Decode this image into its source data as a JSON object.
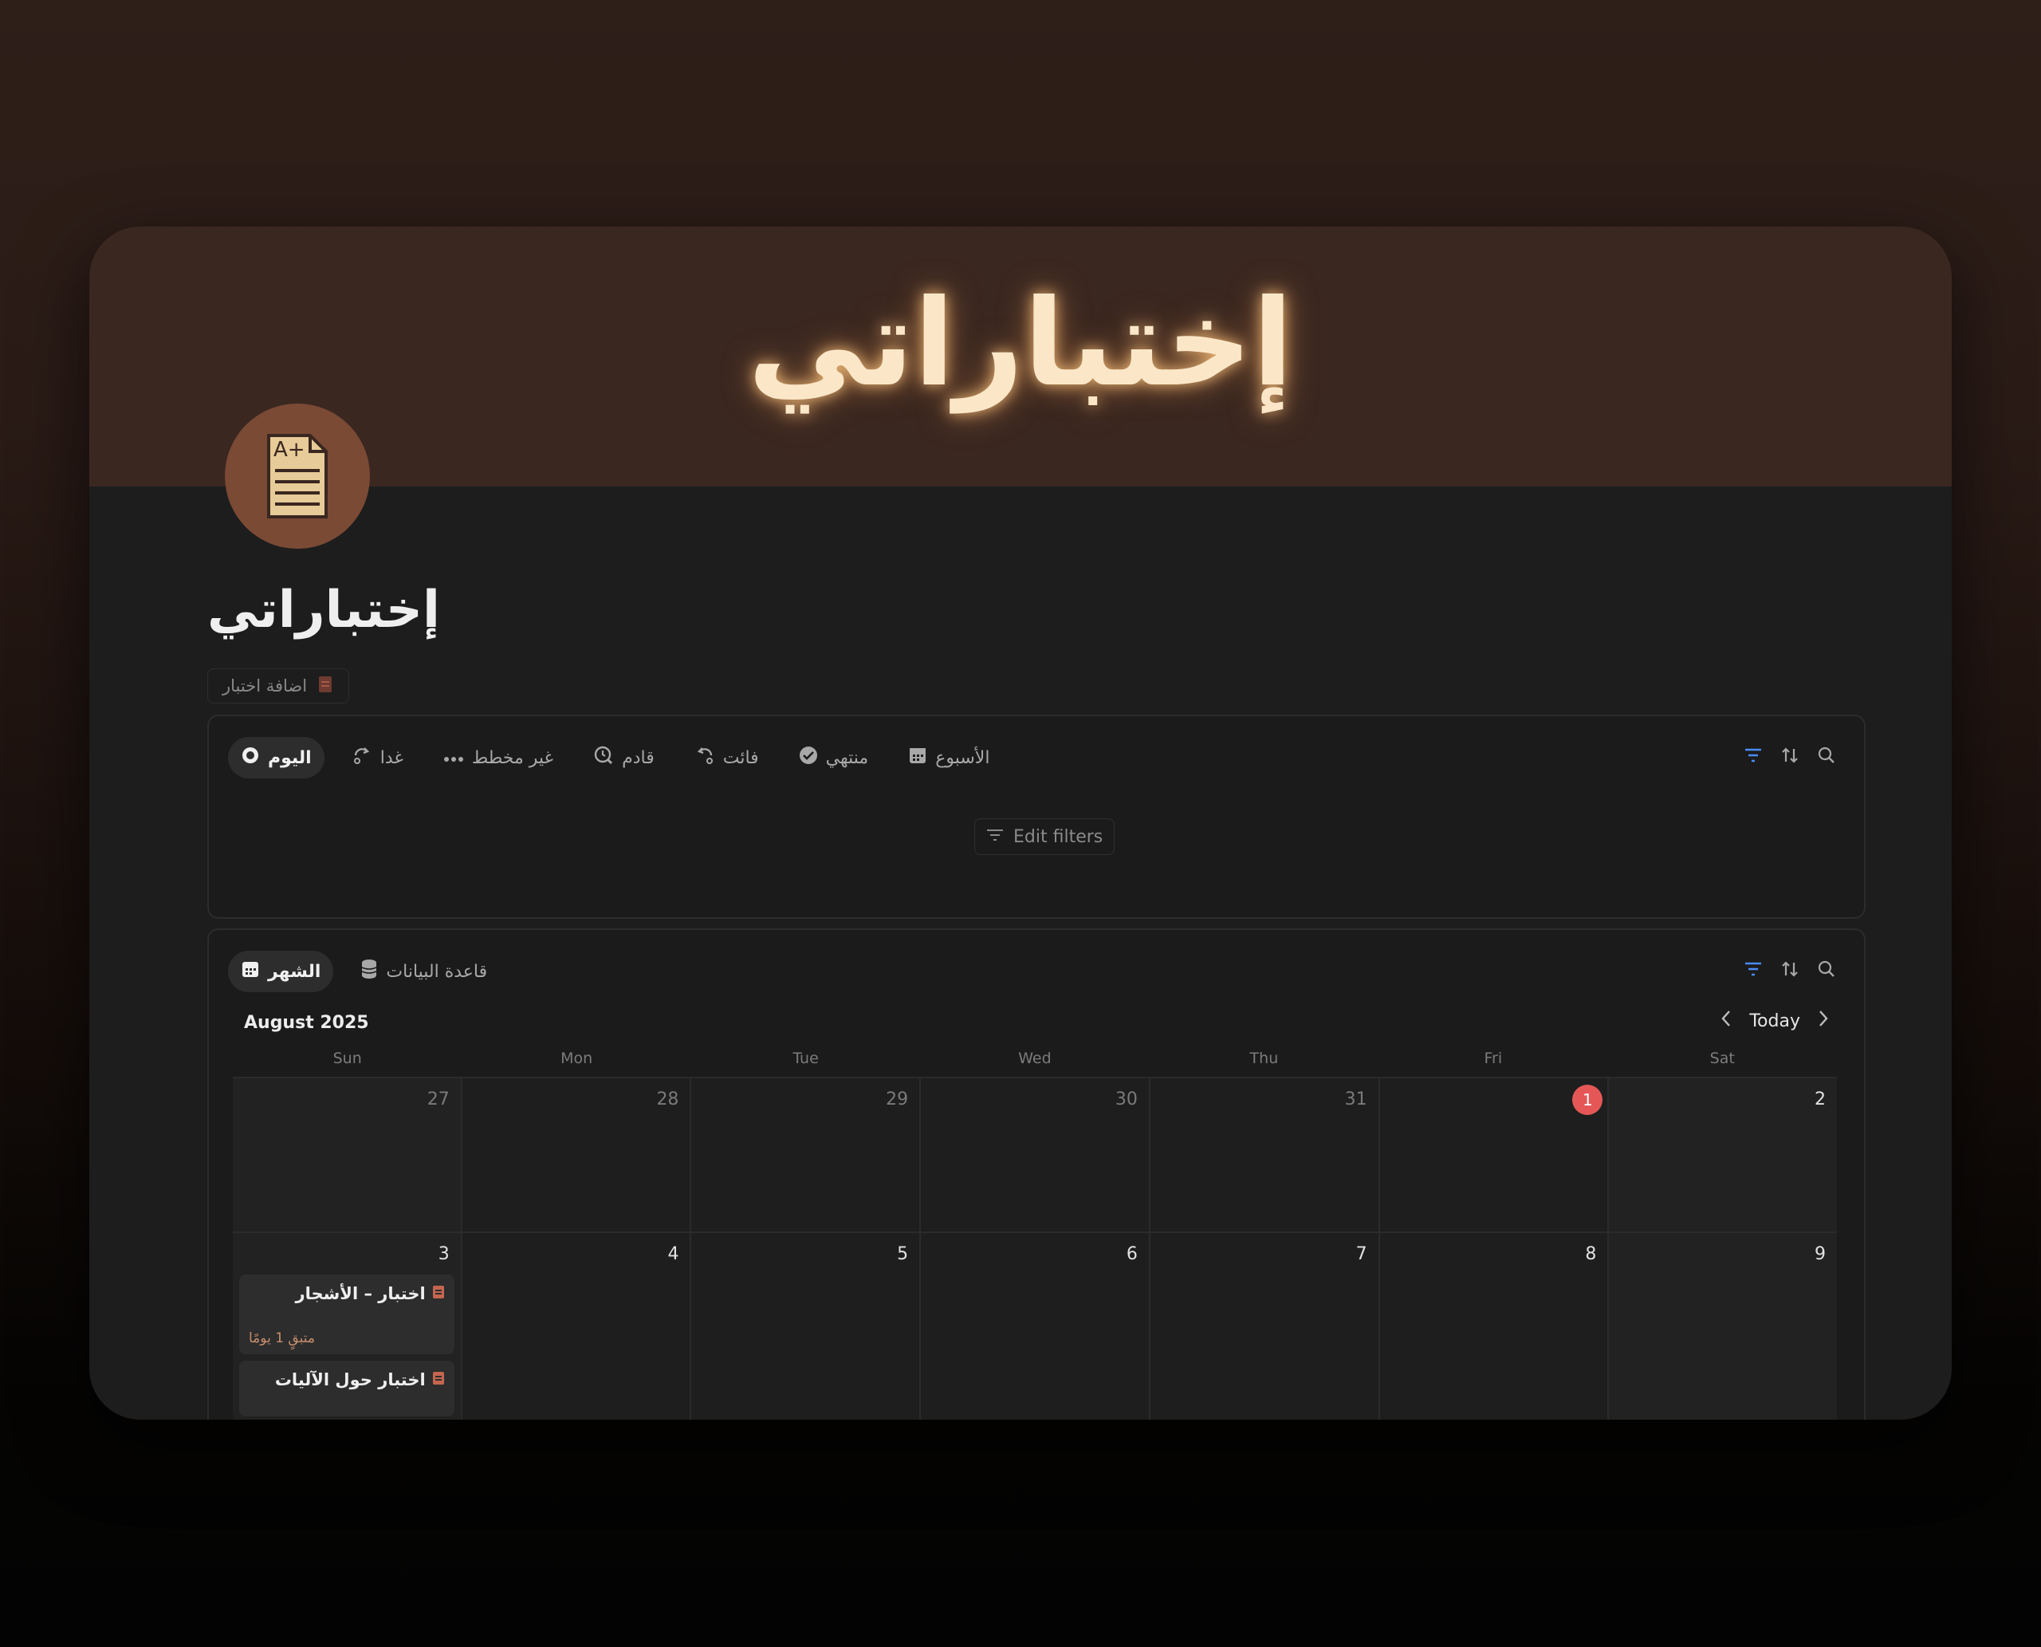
{
  "cover": {
    "title": "إختباراتي"
  },
  "page": {
    "icon": "graded-document-icon",
    "icon_text": "A+",
    "title": "إختباراتي",
    "add_button_label": "اضافة اختبار"
  },
  "filter_view": {
    "tabs": [
      {
        "label": "اليوم",
        "icon": "circle-dot-icon",
        "active": true
      },
      {
        "label": "غدا",
        "icon": "repeat-icon"
      },
      {
        "label": "غير مخطط",
        "icon": "ellipsis-icon"
      },
      {
        "label": "قادم",
        "icon": "clock-search-icon"
      },
      {
        "label": "فائت",
        "icon": "undo-icon"
      },
      {
        "label": "منتهي",
        "icon": "check-circle-icon"
      },
      {
        "label": "الأسبوع",
        "icon": "calendar-icon"
      }
    ],
    "edit_filters_label": "Edit filters"
  },
  "calendar_view": {
    "tabs": [
      {
        "label": "الشهر",
        "icon": "calendar-icon",
        "active": true
      },
      {
        "label": "قاعدة البيانات",
        "icon": "database-icon"
      }
    ],
    "month_label": "August 2025",
    "today_label": "Today",
    "weekdays": [
      "Sun",
      "Mon",
      "Tue",
      "Wed",
      "Thu",
      "Fri",
      "Sat"
    ],
    "weeks": [
      [
        "27",
        "28",
        "29",
        "30",
        "31",
        "1",
        "2"
      ],
      [
        "3",
        "4",
        "5",
        "6",
        "7",
        "8",
        "9"
      ]
    ],
    "today_day": "1",
    "events": [
      {
        "title": "اختبار – الأشجار",
        "subtitle": "متبقٍ 1 يومًا"
      },
      {
        "title": "اختبار حول الآليات",
        "subtitle": ""
      }
    ]
  },
  "colors": {
    "accent_blue": "#4a8cf7",
    "today_red": "#e55757",
    "event_icon": "#c4664f"
  }
}
